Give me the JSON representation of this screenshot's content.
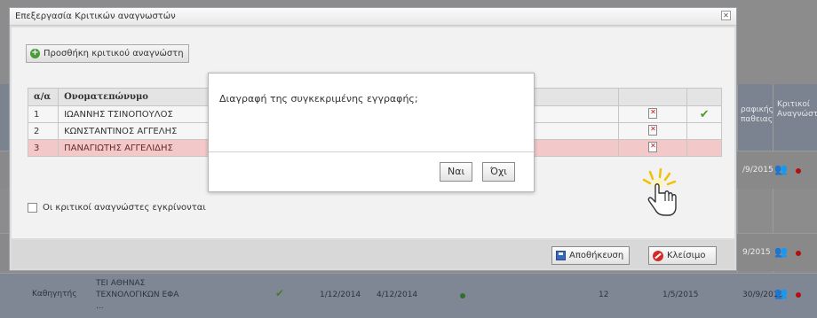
{
  "background": {
    "col_dates": "ραφικής\nπαθειας",
    "col_readers": "Κριτικοί\nΑναγνώστε",
    "rows": [
      {
        "date_end": "/9/2015"
      },
      {
        "date_end": "9/2015"
      }
    ],
    "row3": {
      "role": "Καθηγητής",
      "org_line1": "ΤΕΙ ΑΘΗΝΑΣ",
      "org_line2": "ΤΕΧΝΟΛΟΓΙΚΩΝ ΕΦΑ",
      "org_line3": "...",
      "date1": "1/12/2014",
      "date2": "4/12/2014",
      "count": "12",
      "date3": "1/5/2015",
      "date4": "30/9/2015"
    }
  },
  "dialog": {
    "title": "Επεξεργασία Κριτικών αναγνωστών",
    "close_glyph": "✕",
    "add_button": "Προσθήκη κριτικού αναγνώστη",
    "table": {
      "headers": [
        "α/α",
        "Ονοματεπώνυμο"
      ],
      "rows": [
        {
          "num": "1",
          "name": "ΙΩΑΝΝΗΣ ΤΣΙΝΟΠΟΥΛΟΣ"
        },
        {
          "num": "2",
          "name": "ΚΩΝΣΤΑΝΤΙΝΟΣ ΑΓΓΕΛΗΣ"
        },
        {
          "num": "3",
          "name": "ΠΑΝΑΓΙΩΤΗΣ ΑΓΓΕΛΙΔΗΣ"
        }
      ]
    },
    "approve_label": "Οι κριτικοί αναγνώστες εγκρίνονται",
    "save_button": "Αποθήκευση",
    "close_button": "Κλείσιμο"
  },
  "confirm": {
    "message": "Διαγραφή της συγκεκριμένης εγγραφής;",
    "yes_button": "Ναι",
    "no_button": "Όχι"
  }
}
